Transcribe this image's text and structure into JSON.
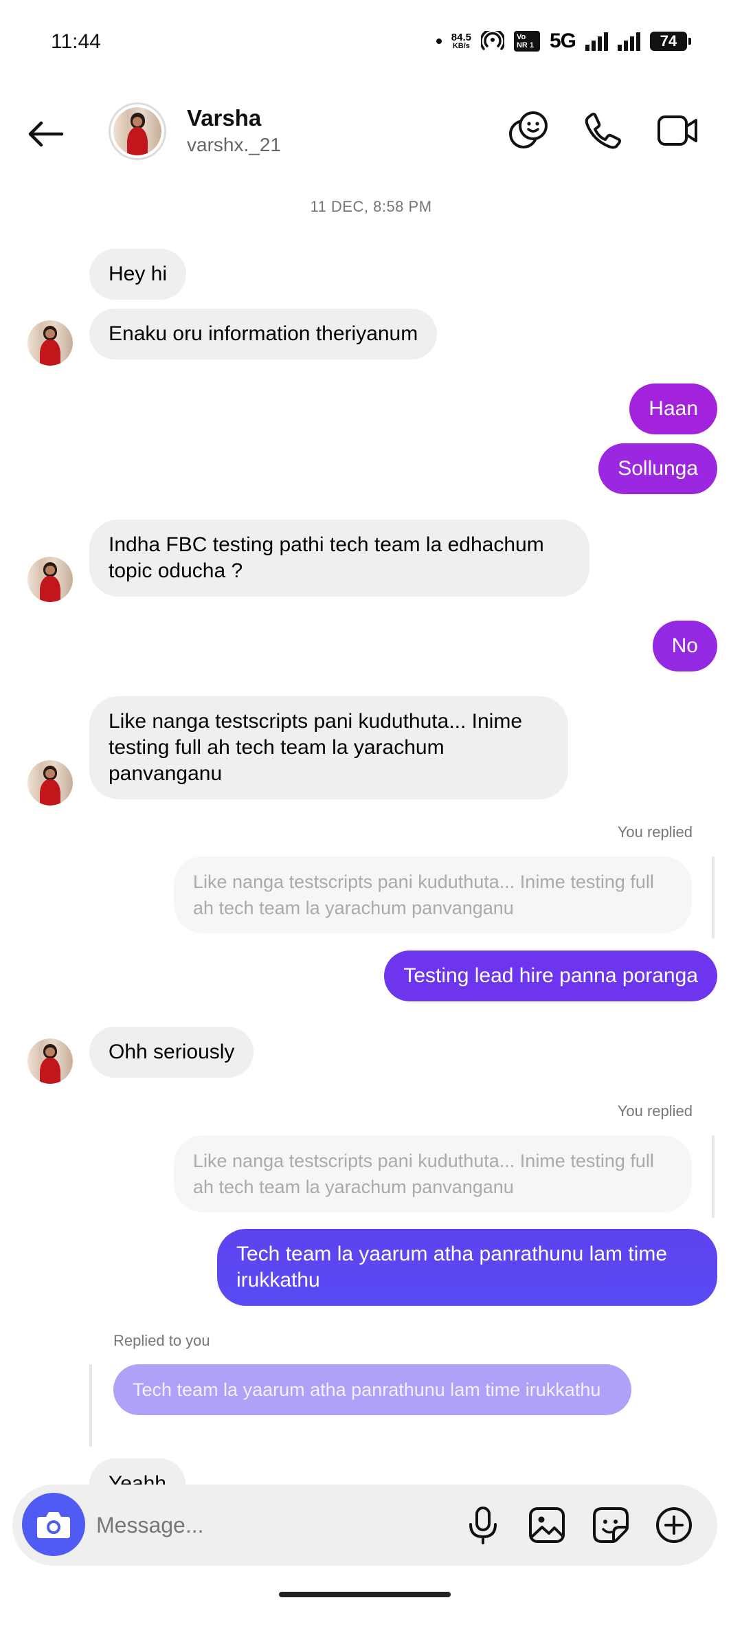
{
  "status_bar": {
    "time": "11:44",
    "speed_value": "84.5",
    "speed_unit": "KB/s",
    "volte": "Vo NR 1",
    "network": "5G",
    "battery": "74"
  },
  "header": {
    "name": "Varsha",
    "handle": "varshx._21"
  },
  "chat": {
    "timestamp": "11 DEC, 8:58 PM",
    "messages": [
      {
        "dir": "in",
        "text": "Hey hi"
      },
      {
        "dir": "in",
        "text": "Enaku oru information theriyanum"
      },
      {
        "dir": "out",
        "text": "Haan"
      },
      {
        "dir": "out",
        "text": "Sollunga"
      },
      {
        "dir": "in",
        "text": "Indha FBC testing pathi tech team la edhachum topic oducha ?"
      },
      {
        "dir": "out",
        "text": "No"
      },
      {
        "dir": "in",
        "text": "Like nanga testscripts pani kuduthuta... Inime testing full ah tech team la yarachum panvanganu"
      },
      {
        "dir": "out",
        "text": "Testing lead hire panna poranga"
      },
      {
        "dir": "in",
        "text": "Ohh seriously"
      },
      {
        "dir": "out",
        "text": "Tech team la yaarum atha panrathunu lam time irukkathu"
      },
      {
        "dir": "in",
        "text": "Yeahh"
      }
    ],
    "reply1_meta": "You replied",
    "reply1_quote": "Like nanga testscripts pani kuduthuta... Inime testing full ah tech team la yarachum panvanganu",
    "reply2_meta": "You replied",
    "reply2_quote": "Like nanga testscripts pani kuduthuta... Inime testing full ah tech team la yarachum panvanganu",
    "reply3_meta": "Replied to you",
    "reply3_quote": "Tech team la yaarum atha panrathunu lam time irukkathu"
  },
  "composer": {
    "placeholder": "Message..."
  },
  "colors": {
    "accent_purple": "#a024dd",
    "accent_violet": "#6d36ee",
    "accent_blue": "#5a47f2",
    "incoming_bg": "#efefef",
    "camera_button": "#4f5bf2"
  },
  "icons": {
    "back": "back-arrow-icon",
    "effects": "effects-icon",
    "call": "phone-icon",
    "video": "video-camera-icon",
    "camera": "camera-icon",
    "mic": "microphone-icon",
    "gallery": "gallery-icon",
    "sticker": "sticker-icon",
    "plus": "plus-circle-icon"
  }
}
